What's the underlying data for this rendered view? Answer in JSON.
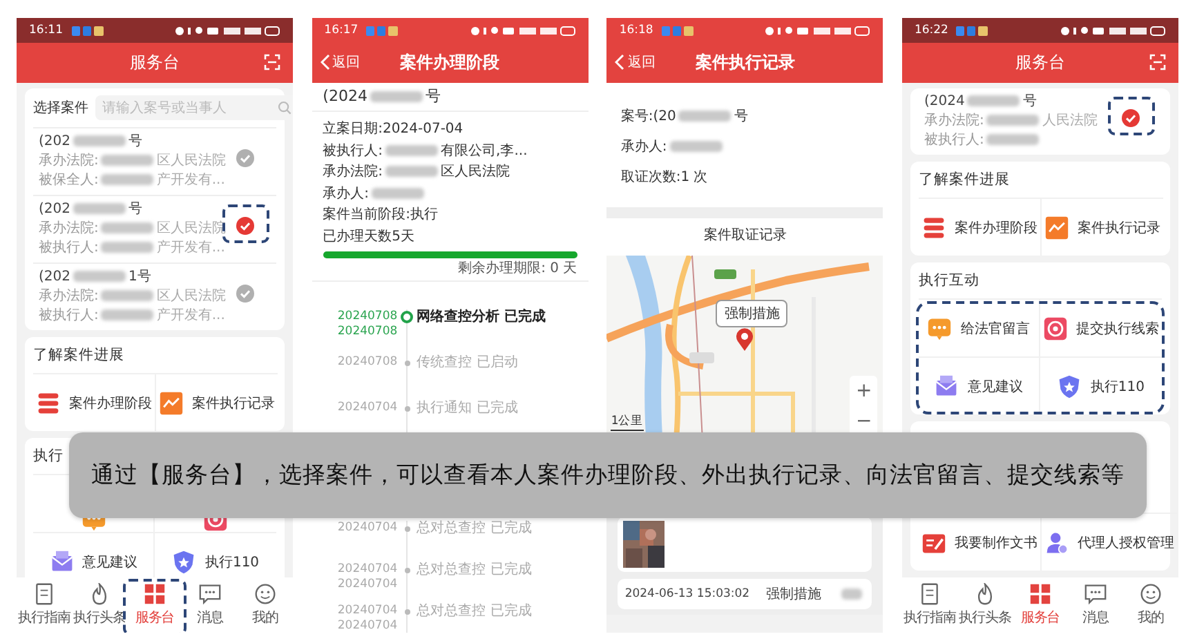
{
  "phones": [
    {
      "kind": "desk",
      "time": "16:11",
      "title": "服务台",
      "search": {
        "label": "选择案件",
        "placeholder": "请输入案号或当事人"
      },
      "cases": [
        {
          "number": {
            "value": "(202",
            "blurred": true,
            "tail": "号"
          },
          "lines": [
            {
              "label": "承办法院:",
              "blurred": true,
              "tail": "区人民法院"
            },
            {
              "label": "被保全人:",
              "blurred": true,
              "tail": "产开发有..."
            }
          ],
          "selected": false,
          "highlighted": false
        },
        {
          "number": {
            "value": "(202",
            "blurred": true,
            "tail": "号"
          },
          "lines": [
            {
              "label": "承办法院:",
              "blurred": true,
              "tail": "区人民法院"
            },
            {
              "label": "被执行人:",
              "blurred": true,
              "tail": "产开发有..."
            }
          ],
          "selected": true,
          "highlighted": true
        },
        {
          "number": {
            "value": "(202",
            "blurred": true,
            "tail": "1号"
          },
          "lines": [
            {
              "label": "承办法院:",
              "blurred": true,
              "tail": "区人民法院"
            },
            {
              "label": "被执行人:",
              "blurred": true,
              "tail": "产开发有..."
            }
          ],
          "selected": false,
          "highlighted": false
        }
      ],
      "sections": [
        {
          "title": "了解案件进展",
          "highlighted": false,
          "items": [
            {
              "kind": "stages",
              "label": "案件办理阶段"
            },
            {
              "kind": "records",
              "label": "案件执行记录"
            }
          ]
        },
        {
          "title": "执行",
          "highlighted": false,
          "items": [
            {
              "kind": "message"
            },
            {
              "kind": "clue"
            },
            {
              "kind": "feedback",
              "label": "意见建议"
            },
            {
              "kind": "hotline",
              "label": "执行110"
            }
          ]
        }
      ],
      "tabs": [
        {
          "label": "执行指南",
          "selected": false,
          "highlighted": false
        },
        {
          "label": "执行头条",
          "selected": false,
          "highlighted": false
        },
        {
          "label": "服务台",
          "selected": true,
          "highlighted": true
        },
        {
          "label": "消息",
          "selected": false,
          "highlighted": false
        },
        {
          "label": "我的",
          "selected": false,
          "highlighted": false
        }
      ]
    },
    {
      "kind": "stage",
      "time": "16:17",
      "back": "返回",
      "title": "案件办理阶段",
      "case_number": {
        "value": "(2024",
        "blurred": true,
        "tail": "号"
      },
      "fields": [
        {
          "label": "立案日期:",
          "value": "2024-07-04"
        },
        {
          "label": "被执行人:",
          "blurred": true,
          "tail": "有限公司,李..."
        },
        {
          "label": "承办法院:",
          "blurred": true,
          "tail": "区人民法院"
        },
        {
          "label": "承办人:",
          "blurred": true
        },
        {
          "label": "案件当前阶段:",
          "value": "执行"
        },
        {
          "label": "已办理天数5天"
        }
      ],
      "progress": {
        "level": 1
      },
      "remaining": "剩余办理期限: 0 天",
      "timeline": [
        {
          "dates": [
            "20240708",
            "20240708"
          ],
          "text": "网络查控分析 已完成",
          "current": true
        },
        {
          "dates": [
            "20240708"
          ],
          "text": "传统查控 已启动",
          "current": false
        },
        {
          "dates": [
            "20240704"
          ],
          "text": "执行通知 已完成",
          "current": false
        },
        {
          "dates": [
            "20240704"
          ],
          "text": "总对总查控 已完成",
          "current": false
        },
        {
          "dates": [
            "20240704",
            "20240704"
          ],
          "text": "总对总查控 已完成",
          "current": false
        },
        {
          "dates": [
            "20240704",
            "20240704"
          ],
          "text": "总对总查控 已完成",
          "current": false
        }
      ]
    },
    {
      "kind": "record",
      "time": "16:18",
      "back": "返回",
      "title": "案件执行记录",
      "fields": [
        {
          "label": "案号:",
          "value": "(20",
          "blurred": true,
          "tail": "号"
        },
        {
          "label": "承办人:",
          "blurred": true
        },
        {
          "label": "取证次数:",
          "value": "1 次"
        }
      ],
      "map_title": "案件取证记录",
      "map": {
        "kind": "picture",
        "marker_label": "强制措施",
        "scale": "1公里",
        "zoom_in": "+",
        "zoom_out": "−"
      },
      "photo": {
        "kind": "picture"
      },
      "record": {
        "time": "2024-06-13 15:03:02",
        "type": "强制措施",
        "blurred": true
      }
    },
    {
      "kind": "desk",
      "time": "16:22",
      "title": "服务台",
      "cases": [
        {
          "number": {
            "value": "(2024",
            "blurred": true,
            "tail": "号"
          },
          "lines": [
            {
              "label": "承办法院:",
              "blurred": true,
              "tail": "人民法院"
            },
            {
              "label": "被执行人:",
              "blurred": true
            }
          ],
          "selected": true,
          "highlighted": true
        }
      ],
      "sections": [
        {
          "title": "了解案件进展",
          "highlighted": false,
          "items": [
            {
              "kind": "stages",
              "label": "案件办理阶段"
            },
            {
              "kind": "records",
              "label": "案件执行记录"
            }
          ]
        },
        {
          "title": "执行互动",
          "highlighted": true,
          "items": [
            {
              "kind": "message",
              "label": "给法官留言"
            },
            {
              "kind": "clue",
              "label": "提交执行线索"
            },
            {
              "kind": "feedback",
              "label": "意见建议"
            },
            {
              "kind": "hotline",
              "label": "执行110"
            }
          ]
        },
        {
          "highlighted": false,
          "items": [
            {
              "kind": "document",
              "label": "我要制作文书"
            },
            {
              "kind": "agent",
              "label": "代理人授权管理"
            }
          ]
        }
      ],
      "tabs": [
        {
          "label": "执行指南",
          "selected": false,
          "highlighted": false
        },
        {
          "label": "执行头条",
          "selected": false,
          "highlighted": false
        },
        {
          "label": "服务台",
          "selected": true,
          "highlighted": false
        },
        {
          "label": "消息",
          "selected": false,
          "highlighted": false
        },
        {
          "label": "我的",
          "selected": false,
          "highlighted": false
        }
      ]
    }
  ],
  "caption": "通过【服务台】，选择案件，可以查看本人案件办理阶段、外出执行记录、向法官留言、提交线索等"
}
